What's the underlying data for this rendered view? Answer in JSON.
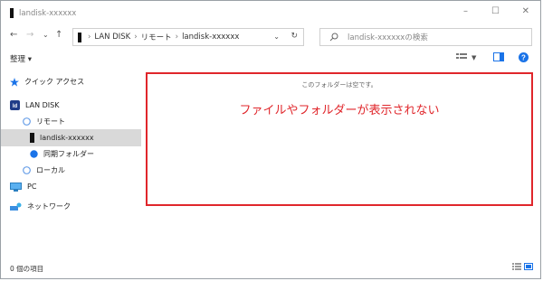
{
  "window": {
    "title": "landisk-xxxxxx"
  },
  "controls": {
    "minimize": "–",
    "maximize": "☐",
    "close": "✕"
  },
  "nav": {
    "back": "←",
    "forward": "→",
    "recent": "⌄",
    "up": "↑"
  },
  "address": {
    "crumbs": [
      "LAN DISK",
      "リモート",
      "landisk-xxxxxx"
    ],
    "separator": "›",
    "dropdown": "⌄",
    "refresh": "↻"
  },
  "search": {
    "placeholder": "landisk-xxxxxxの検索"
  },
  "command": {
    "organize": "整理 ▾"
  },
  "sidebar": {
    "items": [
      {
        "label": "クイック アクセス",
        "icon": "star-icon"
      },
      {
        "label": "LAN DISK",
        "icon": "landisk-logo-icon"
      },
      {
        "label": "リモート",
        "icon": "remote-icon"
      },
      {
        "label": "landisk-xxxxxx",
        "icon": "device-icon",
        "selected": true
      },
      {
        "label": "同期フォルダー",
        "icon": "sync-folder-icon"
      },
      {
        "label": "ローカル",
        "icon": "local-icon"
      },
      {
        "label": "PC",
        "icon": "pc-icon"
      },
      {
        "label": "ネットワーク",
        "icon": "network-icon"
      }
    ]
  },
  "main": {
    "empty_message": "このフォルダーは空です。",
    "annotation": "ファイルやフォルダーが表示されない"
  },
  "status": {
    "item_count": "0 個の項目"
  },
  "colors": {
    "annotation": "#e0262b",
    "accent": "#1a73e8",
    "selected": "#d9d9d9"
  }
}
